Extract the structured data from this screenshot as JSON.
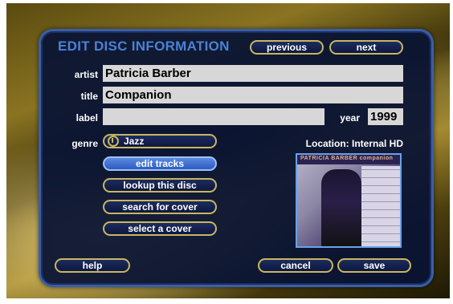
{
  "title": "EDIT DISC INFORMATION",
  "nav": {
    "previous": "previous",
    "next": "next"
  },
  "fields": {
    "artist_label": "artist",
    "artist_value": "Patricia Barber",
    "title_label": "title",
    "title_value": "Companion",
    "label_label": "label",
    "label_value": "",
    "year_label": "year",
    "year_value": "1999",
    "genre_label": "genre",
    "genre_value": "Jazz"
  },
  "actions": {
    "edit_tracks": "edit tracks",
    "lookup": "lookup this disc",
    "search_cover": "search for cover",
    "select_cover": "select a cover"
  },
  "location": "Location: Internal HD",
  "cover": {
    "band_text": "PATRICIA BARBER companion"
  },
  "footer": {
    "help": "help",
    "cancel": "cancel",
    "save": "save"
  },
  "colors": {
    "accent": "#4a82d6",
    "button_border": "#c9b660",
    "panel": "#08123a"
  }
}
